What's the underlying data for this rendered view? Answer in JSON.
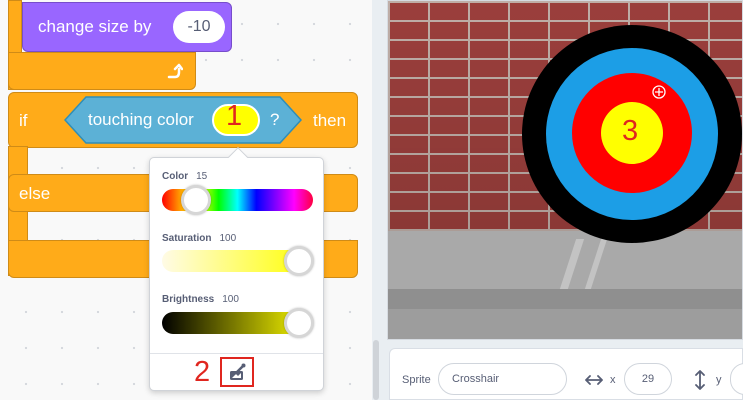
{
  "blocks": {
    "change_size_label": "change size by",
    "change_size_value": "-10",
    "repeat_arrow_icon": "rotate-arrow-icon",
    "if_label": "if",
    "touching_color_label": "touching color",
    "question_mark": "?",
    "then_label": "then",
    "else_label": "else"
  },
  "color_picker": {
    "color_label": "Color",
    "color_value": 15,
    "saturation_label": "Saturation",
    "saturation_value": 100,
    "brightness_label": "Brightness",
    "brightness_value": 100,
    "eyedropper_icon": "eyedropper-icon",
    "selected_color": "#ffff00"
  },
  "annotations": {
    "step1": "1",
    "step2": "2",
    "step3": "3"
  },
  "stage": {
    "target_colors": {
      "outer": "#000000",
      "ring2": "#1c9ee6",
      "ring3": "#ff0000",
      "center": "#ffff00"
    }
  },
  "sprite_info": {
    "sprite_label": "Sprite",
    "sprite_name": "Crosshair",
    "x_icon": "horizontal-arrows-icon",
    "x_label": "x",
    "x_value": "29",
    "y_icon": "vertical-arrows-icon",
    "y_label": "y"
  }
}
